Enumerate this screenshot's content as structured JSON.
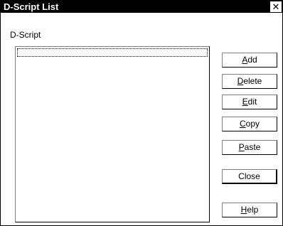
{
  "window": {
    "title": "D-Script List",
    "close_glyph": "✕"
  },
  "list": {
    "label": "D-Script",
    "items": []
  },
  "buttons": {
    "add": {
      "mnemonic": "A",
      "rest": "dd"
    },
    "delete": {
      "mnemonic": "D",
      "rest": "elete"
    },
    "edit": {
      "mnemonic": "E",
      "rest": "dit"
    },
    "copy": {
      "mnemonic": "C",
      "rest": "opy"
    },
    "paste": {
      "mnemonic": "P",
      "rest": "aste"
    },
    "close": {
      "label": "Close"
    },
    "help": {
      "mnemonic": "H",
      "rest": "elp"
    }
  }
}
